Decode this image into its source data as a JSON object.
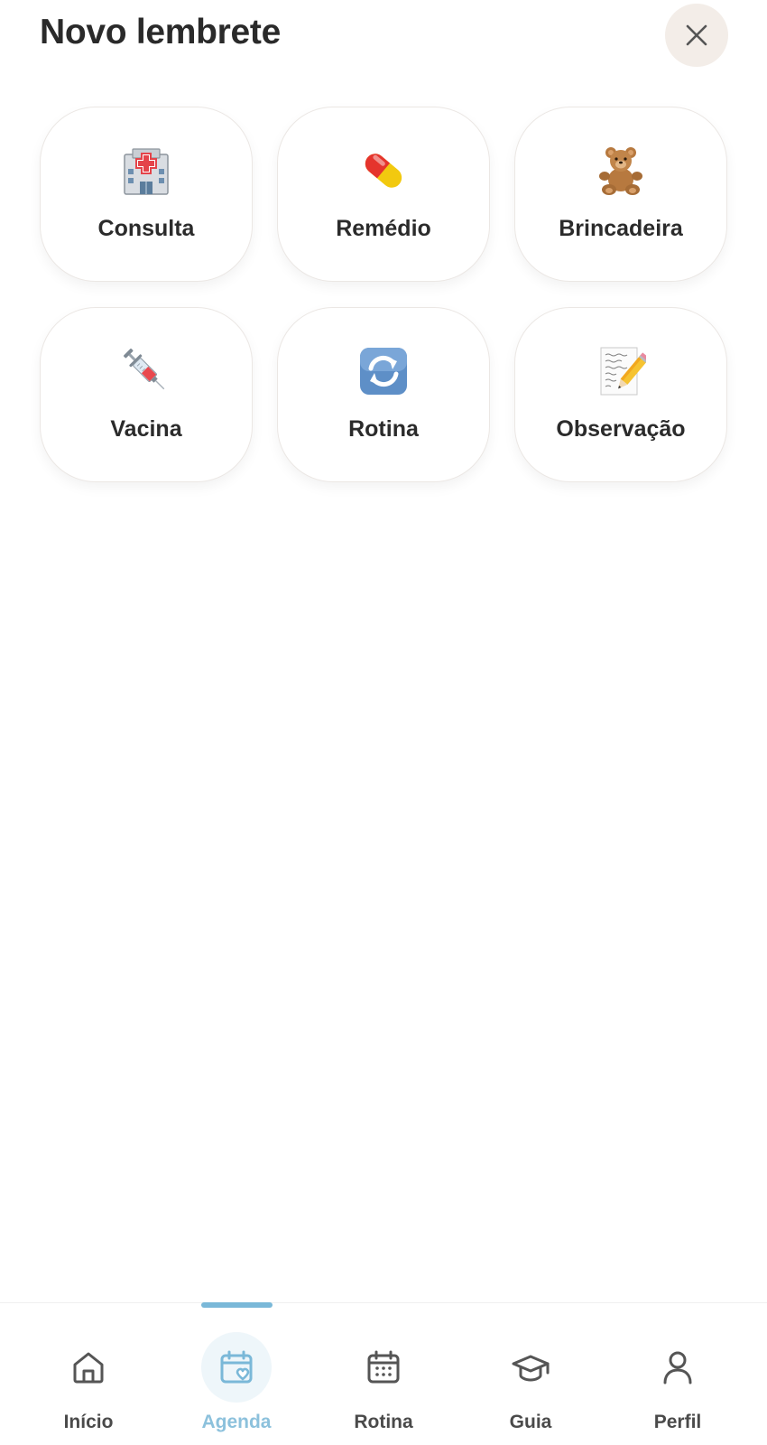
{
  "header": {
    "title": "Novo lembrete",
    "close_icon": "close-icon"
  },
  "options": [
    {
      "label": "Consulta",
      "emoji": "🏥",
      "icon": "hospital-icon"
    },
    {
      "label": "Remédio",
      "emoji": "💊",
      "icon": "pill-icon"
    },
    {
      "label": "Brincadeira",
      "emoji": "🧸",
      "icon": "teddy-bear-icon"
    },
    {
      "label": "Vacina",
      "emoji": "💉",
      "icon": "syringe-icon"
    },
    {
      "label": "Rotina",
      "emoji": "🔄",
      "icon": "repeat-icon"
    },
    {
      "label": "Observação",
      "emoji": "📝",
      "icon": "memo-icon"
    }
  ],
  "tabbar": {
    "active_index": 1,
    "active_color": "#7ab8d8",
    "items": [
      {
        "label": "Início",
        "icon": "home-icon"
      },
      {
        "label": "Agenda",
        "icon": "calendar-heart-icon"
      },
      {
        "label": "Rotina",
        "icon": "calendar-grid-icon"
      },
      {
        "label": "Guia",
        "icon": "graduation-cap-icon"
      },
      {
        "label": "Perfil",
        "icon": "user-icon"
      }
    ]
  }
}
